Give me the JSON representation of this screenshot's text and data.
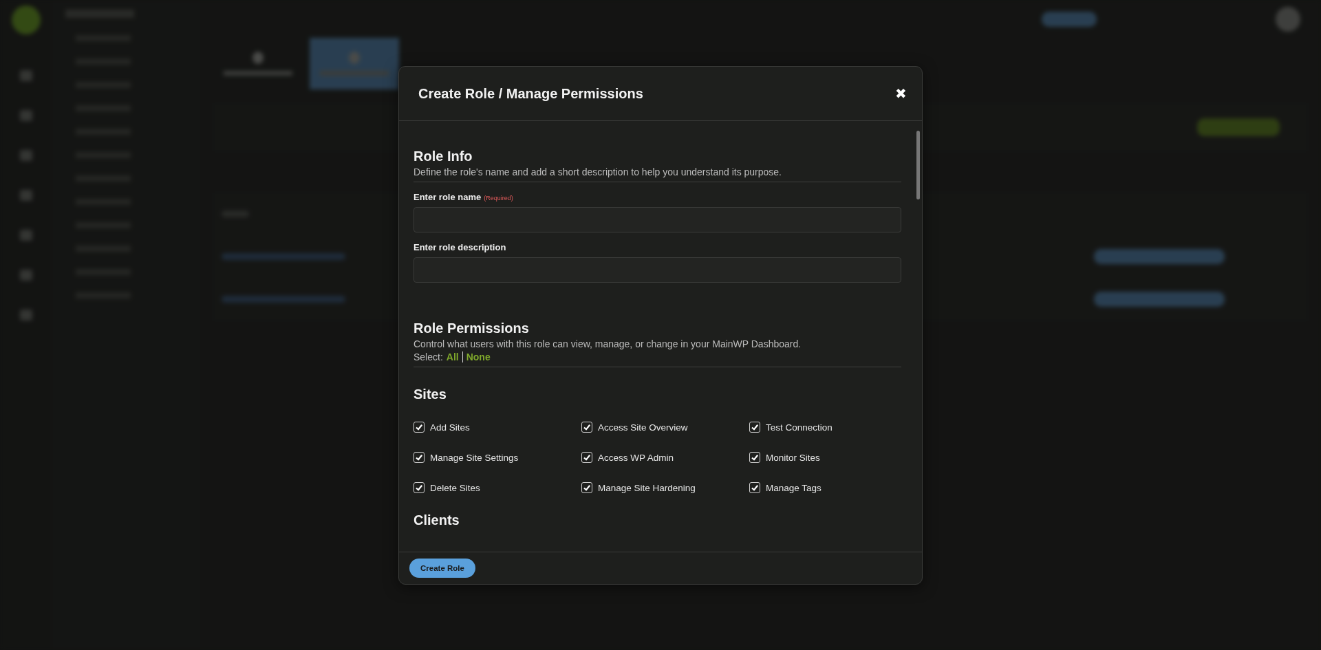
{
  "modal": {
    "title": "Create Role / Manage Permissions",
    "close": "✖",
    "role_info": {
      "heading": "Role Info",
      "description": "Define the role's name and add a short description to help you understand its purpose.",
      "fields": [
        {
          "label": "Enter role name",
          "required": "(Required)"
        },
        {
          "label": "Enter role description"
        }
      ]
    },
    "role_permissions": {
      "heading": "Role Permissions",
      "description": "Control what users with this role can view, manage, or change in your MainWP Dashboard.",
      "select_label": "Select:",
      "select_all": "All",
      "select_none": "None"
    },
    "groups": [
      {
        "heading": "Sites",
        "permissions": [
          {
            "label": "Add Sites",
            "checked": true
          },
          {
            "label": "Access Site Overview",
            "checked": true
          },
          {
            "label": "Test Connection",
            "checked": true
          },
          {
            "label": "Manage Site Settings",
            "checked": true
          },
          {
            "label": "Access WP Admin",
            "checked": true
          },
          {
            "label": "Monitor Sites",
            "checked": true
          },
          {
            "label": "Delete Sites",
            "checked": true
          },
          {
            "label": "Manage Site Hardening",
            "checked": true
          },
          {
            "label": "Manage Tags",
            "checked": true
          }
        ]
      },
      {
        "heading": "Clients"
      }
    ],
    "submit": "Create Role"
  }
}
